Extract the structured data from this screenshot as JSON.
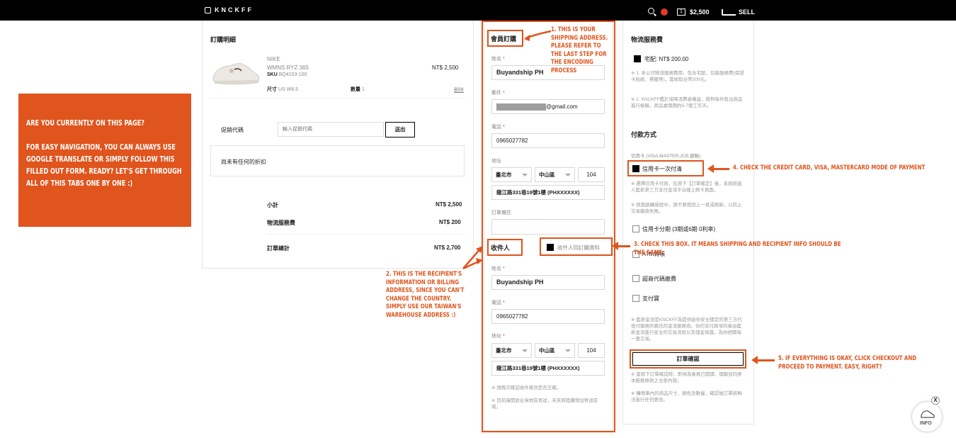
{
  "topbar": {
    "logo": "KNCKFF",
    "cart_count": "1",
    "balance": "$2,500",
    "sell": "SELL"
  },
  "note": {
    "line1": "ARE YOU CURRENTLY ON THIS PAGE?",
    "line2": "FOR EASY NAVIGATION, YOU CAN ALWAYS USE GOOGLE TRANSLATE OR SIMPLY FOLLOW THIS FILLED OUT FORM. READY? LET'S GET THROUGH ALL OF THIS TABS ONE BY ONE :)"
  },
  "order": {
    "title": "訂購明細",
    "brand": "NIKE",
    "product": "WMNS RYZ 365",
    "sku_label": "SKU",
    "sku": "BQ4153-100",
    "price": "NT$ 2,500",
    "size_label": "尺寸",
    "size": "US W8.5",
    "qty_label": "數量",
    "qty": "1",
    "delete": "刪除",
    "promo_label": "促銷代碼",
    "promo_placeholder": "輸入促銷代碼",
    "promo_button": "送出",
    "no_discount": "尚未有任何的折扣",
    "subtotal_label": "小計",
    "subtotal": "NT$ 2,500",
    "shipping_label": "物流服務費",
    "shipping": "NT$ 200",
    "total_label": "訂單總計",
    "total": "NT$ 2,700"
  },
  "member": {
    "title": "會員訂購",
    "name_label": "姓名",
    "name": "Buyandship PH",
    "email_label": "郵件",
    "email_suffix": "@gmail.com",
    "phone_label": "電話",
    "phone": "0965027782",
    "address_label": "地址",
    "city": "臺北市",
    "district": "中山區",
    "zip": "104",
    "street": "龍江路331巷19號1樓 (PHXXXXXX)",
    "remark_label": "訂單備註"
  },
  "recipient": {
    "title": "收件人",
    "same_as": "收件人同訂購資料",
    "name_label": "姓名",
    "name": "Buyandship PH",
    "phone_label": "電話",
    "phone": "0965027782",
    "address_label": "地址",
    "city": "臺北市",
    "district": "中山區",
    "zip": "104",
    "street": "龍江路331巷19號1樓 (PHXXXXXX)",
    "note1": "※ 請再次確認收件資訊是否正確。",
    "note2": "※ 目前僅開放台灣地區寄送，未來將陸續增加寄送區域。"
  },
  "shipping": {
    "title": "物流服務費",
    "option": "宅配: NT$ 200.00",
    "note1": "※ 1. 本公司物流服務費用，包含宅配、包裝服務費(保證卡貼紙、標籤等)，需收取台幣200元。",
    "note2": "※ 2. KNCKFF鑑於保障消費者權益，將對每件售出商品進行檢驗，商品處理期約5-7個工作天。"
  },
  "payment": {
    "title": "付款方式",
    "card_types": "信用卡 (VISA,MASTER,JCB,銀聯)",
    "card_once": "信用卡一次付清",
    "card_note1": "※ 選擇信用卡付款，在按下【訂單確定】後，系統將進入藍新第三方支付金流平台線上刷卡頁面。",
    "card_note2": "※ 頁面跳轉過程中，請不要按回上一頁或刷新，以防止交易繳款失敗。",
    "installment": "信用卡分期 (3期或6期 0利率)",
    "atm": "ATM轉帳",
    "cvs": "超商代碼繳費",
    "alipay": "支付寶",
    "gateway_note": "※ 藍新金流是KNCKFF為提供給你安全穩定的第三方代收付服務所委託的金流服務商。你的支付款項均會由藍新金流進行安全的交易流程以及儲金保護，為你把關每一筆交易。",
    "checkout": "訂單確認",
    "after1": "※ 當按下訂單確認時，即視為會員已閱讀、理解並同意本服務條款之全部內容。",
    "after2": "※ 購物車內的商品尺寸、顏色及數量，確認後訂單將無法進行任何更改。"
  },
  "annotations": {
    "a1": "1. THIS IS YOUR SHIPPING ADDRESS. PLEASE REFER TO THE LAST STEP FOR THE ENCODING PROCESS",
    "a2": "2. THIS IS THE RECIPIENT'S INFORMATION OR BILLING ADDRESS, SINCE YOU CAN'T CHANGE THE COUNTRY. SIMPLY USE OUR TAIWAN'S WAREHOUSE ADDRESS :)",
    "a3": "3. CHECK THIS BOX. IT MEANS SHIPPING AND RECIPIENT INFO SHOULD BE THE SAME.",
    "a4": "4. CHECK THE CREDIT CARD, VISA, MASTERCARD MODE OF PAYMENT",
    "a5": "5. IF EVERYTHING IS OKAY, CLICK CHECKOUT AND PROCEED TO PAYMENT. EASY, RIGHT?"
  },
  "info_badge": "INFO",
  "info_close": "X"
}
